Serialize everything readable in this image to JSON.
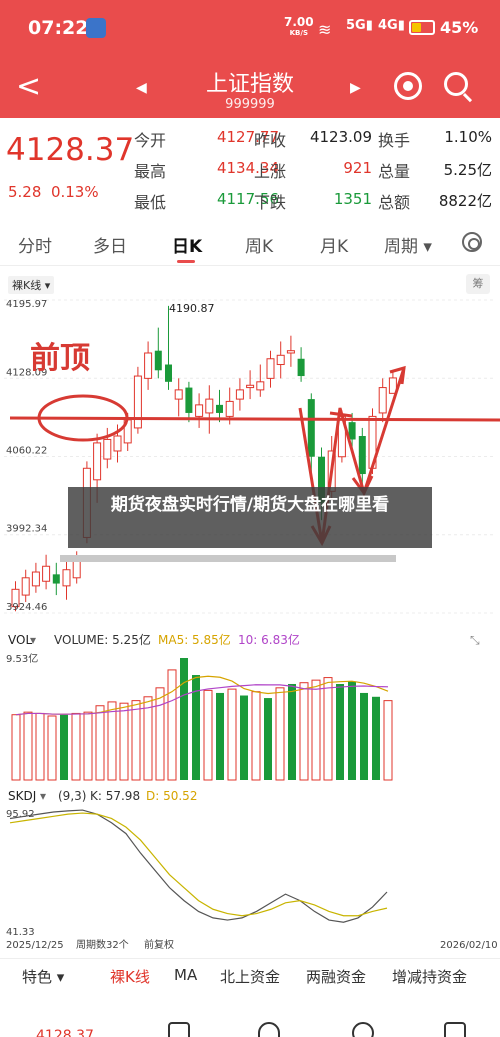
{
  "status": {
    "time": "07:22",
    "net_speed": "7.00",
    "net_unit": "KB/S",
    "battery": "45%",
    "sig1": "5G",
    "sig2": "4G"
  },
  "header": {
    "title": "上证指数",
    "code": "999999"
  },
  "quote": {
    "price": "4128.37",
    "change": "5.28",
    "change_pct": "0.13%",
    "rows": [
      [
        {
          "label": "今开",
          "value": "4127.77",
          "color": "red"
        },
        {
          "label": "昨收",
          "value": "4123.09",
          "color": "dark"
        },
        {
          "label": "换手",
          "value": "1.10%",
          "color": "dark"
        }
      ],
      [
        {
          "label": "最高",
          "value": "4134.34",
          "color": "red"
        },
        {
          "label": "上涨",
          "value": "921",
          "color": "red"
        },
        {
          "label": "总量",
          "value": "5.25亿",
          "color": "dark"
        }
      ],
      [
        {
          "label": "最低",
          "value": "4117.56",
          "color": "green"
        },
        {
          "label": "下跌",
          "value": "1351",
          "color": "green"
        },
        {
          "label": "总额",
          "value": "8822亿",
          "color": "dark"
        }
      ]
    ]
  },
  "tabs": [
    "分时",
    "多日",
    "日K",
    "周K",
    "月K",
    "周期"
  ],
  "chart_labels": {
    "kline_tag": "裸K线",
    "max_mark": "4190.87",
    "annotation": "前顶",
    "vol_label": "VOL",
    "vol_value": "VOLUME: 5.25亿",
    "ma5": "MA5: 5.85亿",
    "ma10": "10: 6.83亿",
    "vol_axis": "9.53亿",
    "skdj_label": "SKDJ",
    "skdj_params": "(9,3)",
    "skdj_k": "K: 57.98",
    "skdj_d": "D: 50.52",
    "skdj_top": "95.92",
    "skdj_bottom": "41.33",
    "date_start": "2025/12/25",
    "week_info": "周期数32个",
    "fq": "前复权",
    "date_end": "2026/02/10",
    "corner": "筹"
  },
  "y_ticks": [
    "4195.97",
    "4128.09",
    "4060.22",
    "3992.34",
    "3924.46"
  ],
  "overlay_text": "期货夜盘实时行情/期货大盘在哪里看",
  "indicator_tabs": [
    "特色",
    "裸K线",
    "MA",
    "北上资金",
    "两融资金",
    "增减持资金"
  ],
  "bottom_price": "4128.37",
  "colors": {
    "up": "#e0352b",
    "down": "#1a9a3a",
    "header": "#e94c4c"
  },
  "chart_data": {
    "type": "candlestick",
    "ylim": [
      3924.46,
      4195.97
    ],
    "candles": [
      {
        "o": 3930,
        "c": 3945,
        "h": 3952,
        "l": 3926
      },
      {
        "o": 3940,
        "c": 3955,
        "h": 3962,
        "l": 3934
      },
      {
        "o": 3948,
        "c": 3960,
        "h": 3968,
        "l": 3942
      },
      {
        "o": 3952,
        "c": 3965,
        "h": 3975,
        "l": 3945
      },
      {
        "o": 3958,
        "c": 3950,
        "h": 3968,
        "l": 3940
      },
      {
        "o": 3948,
        "c": 3962,
        "h": 3972,
        "l": 3936
      },
      {
        "o": 3955,
        "c": 3970,
        "h": 3978,
        "l": 3950
      },
      {
        "o": 3990,
        "c": 4050,
        "h": 4056,
        "l": 3985
      },
      {
        "o": 4040,
        "c": 4072,
        "h": 4080,
        "l": 4020
      },
      {
        "o": 4058,
        "c": 4075,
        "h": 4085,
        "l": 4050
      },
      {
        "o": 4065,
        "c": 4078,
        "h": 4088,
        "l": 4055
      },
      {
        "o": 4072,
        "c": 4092,
        "h": 4098,
        "l": 4065
      },
      {
        "o": 4085,
        "c": 4130,
        "h": 4138,
        "l": 4080
      },
      {
        "o": 4128,
        "c": 4150,
        "h": 4160,
        "l": 4118
      },
      {
        "o": 4152,
        "c": 4135,
        "h": 4172,
        "l": 4128
      },
      {
        "o": 4140,
        "c": 4125,
        "h": 4190.87,
        "l": 4118
      },
      {
        "o": 4110,
        "c": 4118,
        "h": 4128,
        "l": 4095
      },
      {
        "o": 4120,
        "c": 4098,
        "h": 4125,
        "l": 4090
      },
      {
        "o": 4095,
        "c": 4105,
        "h": 4115,
        "l": 4085
      },
      {
        "o": 4098,
        "c": 4110,
        "h": 4122,
        "l": 4080
      },
      {
        "o": 4105,
        "c": 4098,
        "h": 4118,
        "l": 4090
      },
      {
        "o": 4095,
        "c": 4108,
        "h": 4120,
        "l": 4088
      },
      {
        "o": 4110,
        "c": 4118,
        "h": 4128,
        "l": 4100
      },
      {
        "o": 4120,
        "c": 4122,
        "h": 4135,
        "l": 4110
      },
      {
        "o": 4118,
        "c": 4125,
        "h": 4140,
        "l": 4112
      },
      {
        "o": 4128,
        "c": 4145,
        "h": 4152,
        "l": 4120
      },
      {
        "o": 4140,
        "c": 4148,
        "h": 4160,
        "l": 4128
      },
      {
        "o": 4150,
        "c": 4152,
        "h": 4165,
        "l": 4138
      },
      {
        "o": 4145,
        "c": 4130,
        "h": 4155,
        "l": 4125
      },
      {
        "o": 4110,
        "c": 4060,
        "h": 4115,
        "l": 4040
      },
      {
        "o": 4060,
        "c": 4020,
        "h": 4068,
        "l": 4005
      },
      {
        "o": 4030,
        "c": 4065,
        "h": 4078,
        "l": 4015
      },
      {
        "o": 4060,
        "c": 4095,
        "h": 4100,
        "l": 4055
      },
      {
        "o": 4090,
        "c": 4075,
        "h": 4098,
        "l": 4065
      },
      {
        "o": 4078,
        "c": 4045,
        "h": 4085,
        "l": 4035
      },
      {
        "o": 4050,
        "c": 4095,
        "h": 4102,
        "l": 4045
      },
      {
        "o": 4098,
        "c": 4120,
        "h": 4128,
        "l": 4090
      },
      {
        "o": 4115,
        "c": 4128.37,
        "h": 4134.34,
        "l": 4117.56
      }
    ],
    "volume": [
      5.1,
      5.3,
      5.2,
      5.0,
      5.1,
      5.2,
      5.3,
      5.8,
      6.1,
      6.0,
      6.2,
      6.5,
      7.2,
      8.6,
      9.53,
      8.2,
      7.0,
      6.8,
      7.1,
      6.6,
      6.9,
      6.4,
      7.2,
      7.5,
      7.6,
      7.8,
      8.0,
      7.5,
      7.7,
      6.8,
      6.5,
      6.2,
      6.0,
      5.9,
      5.7,
      5.5,
      5.4,
      5.25
    ],
    "volume_up": [
      true,
      true,
      true,
      true,
      false,
      true,
      true,
      true,
      true,
      true,
      true,
      true,
      true,
      true,
      false,
      false,
      true,
      false,
      true,
      false,
      true,
      false,
      true,
      false,
      true,
      true,
      true,
      false,
      false,
      false,
      false,
      true,
      true,
      false,
      false,
      true,
      true,
      true
    ],
    "skdj_k": [
      92,
      93,
      94,
      95,
      95.5,
      95.9,
      94,
      90,
      85,
      76,
      68,
      60,
      54,
      49,
      46,
      45,
      46,
      49,
      53,
      57,
      54,
      49,
      45,
      44,
      46,
      51,
      57.98
    ],
    "skdj_d": [
      90,
      91,
      92,
      93,
      94,
      94.5,
      94,
      92,
      88,
      82,
      74,
      66,
      60,
      54,
      50,
      48,
      47,
      48,
      50,
      53,
      54,
      52,
      49,
      47,
      47,
      49,
      50.52
    ]
  }
}
